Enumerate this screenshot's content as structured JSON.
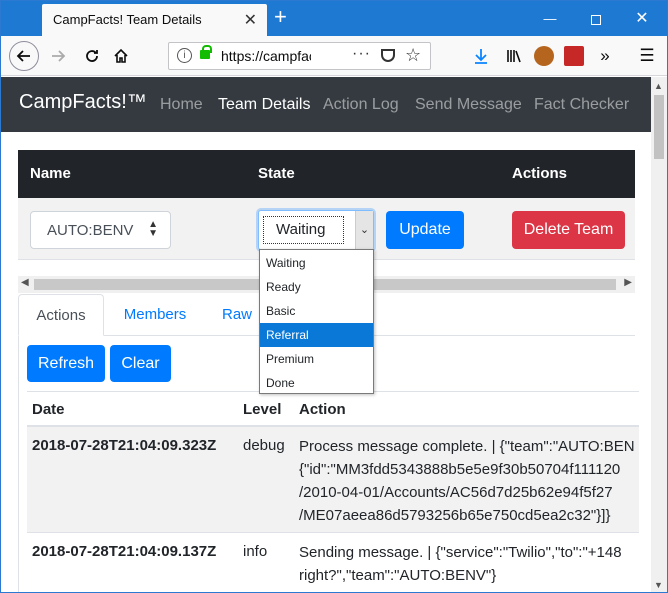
{
  "browser": {
    "tab_title": "CampFacts! Team Details",
    "tab_close": "✕",
    "new_tab": "+",
    "url": "https://campfacts",
    "win_min": "—",
    "win_close": "✕"
  },
  "navbar": {
    "brand": "CampFacts!™",
    "links": [
      {
        "label": "Home",
        "active": false
      },
      {
        "label": "Team Details",
        "active": true
      },
      {
        "label": "Action Log",
        "active": false
      },
      {
        "label": "Send Message",
        "active": false
      },
      {
        "label": "Fact Checker",
        "active": false
      }
    ]
  },
  "team_table": {
    "headers": {
      "name": "Name",
      "state": "State",
      "actions": "Actions"
    },
    "team_value": "AUTO:BENV",
    "state_value": "Waiting",
    "update_label": "Update",
    "delete_label": "Delete Team"
  },
  "state_options": [
    "Waiting",
    "Ready",
    "Basic",
    "Referral",
    "Premium",
    "Done"
  ],
  "state_options_highlighted": "Referral",
  "tabs": {
    "actions": "Actions",
    "members": "Members",
    "raw": "Raw"
  },
  "log": {
    "refresh_label": "Refresh",
    "clear_label": "Clear",
    "headers": {
      "date": "Date",
      "level": "Level",
      "action": "Action"
    },
    "rows": [
      {
        "date": "2018-07-28T21:04:09.323Z",
        "level": "debug",
        "action_lines": [
          "Process message complete. | {\"team\":\"AUTO:BEN",
          "{\"id\":\"MM3fdd5343888b5e5e9f30b50704f111120",
          "/2010-04-01/Accounts/AC56d7d25b62e94f5f27",
          "/ME07aeea86d5793256b65e750cd5ea2c32\"}]}"
        ]
      },
      {
        "date": "2018-07-28T21:04:09.137Z",
        "level": "info",
        "action_lines": [
          "Sending message. | {\"service\":\"Twilio\",\"to\":\"+148",
          "right?\",\"team\":\"AUTO:BENV\"}"
        ]
      }
    ]
  },
  "colors": {
    "browser_blue": "#1e79d3",
    "navbar_dark": "#343a40",
    "primary": "#007bff",
    "danger": "#dc3545",
    "option_highlight": "#0a78d7"
  }
}
